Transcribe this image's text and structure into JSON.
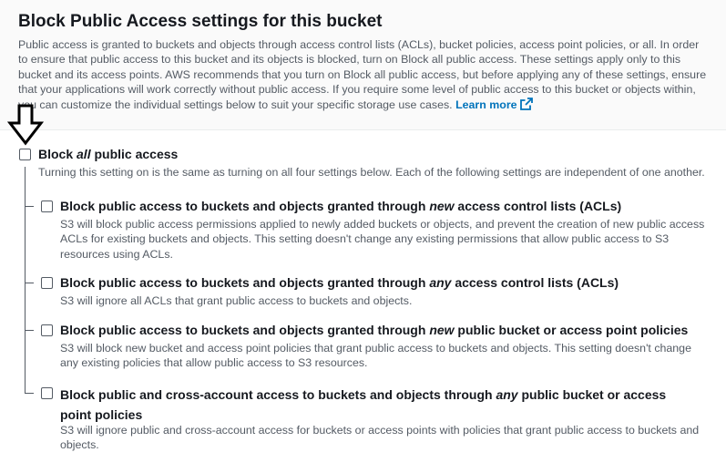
{
  "header": {
    "title": "Block Public Access settings for this bucket",
    "description": "Public access is granted to buckets and objects through access control lists (ACLs), bucket policies, access point policies, or all. In order to ensure that public access to this bucket and its objects is blocked, turn on Block all public access. These settings apply only to this bucket and its access points. AWS recommends that you turn on Block all public access, but before applying any of these settings, ensure that your applications will work correctly without public access. If you require some level of public access to this bucket or objects within, you can customize the individual settings below to suit your specific storage use cases.",
    "learn_more": "Learn more"
  },
  "block_all": {
    "label_prefix": "Block ",
    "label_em": "all",
    "label_suffix": " public access",
    "checked": false,
    "description": "Turning this setting on is the same as turning on all four settings below. Each of the following settings are independent of one another."
  },
  "settings": [
    {
      "label_prefix": "Block public access to buckets and objects granted through ",
      "label_em": "new",
      "label_suffix": " access control lists (ACLs)",
      "checked": false,
      "description": "S3 will block public access permissions applied to newly added buckets or objects, and prevent the creation of new public access ACLs for existing buckets and objects. This setting doesn't change any existing permissions that allow public access to S3 resources using ACLs."
    },
    {
      "label_prefix": "Block public access to buckets and objects granted through ",
      "label_em": "any",
      "label_suffix": " access control lists (ACLs)",
      "checked": false,
      "description": "S3 will ignore all ACLs that grant public access to buckets and objects."
    },
    {
      "label_prefix": "Block public access to buckets and objects granted through ",
      "label_em": "new",
      "label_suffix": " public bucket or access point policies",
      "checked": false,
      "description": "S3 will block new bucket and access point policies that grant public access to buckets and objects. This setting doesn't change any existing policies that allow public access to S3 resources."
    },
    {
      "label_prefix": "Block public and cross-account access to buckets and objects through ",
      "label_em": "any",
      "label_suffix": " public bucket or access point policies",
      "checked": false,
      "description": "S3 will ignore public and cross-account access for buckets or access points with policies that grant public access to buckets and objects."
    }
  ],
  "colors": {
    "text": "#16191f",
    "secondary_text": "#545b64",
    "link": "#0073bb",
    "header_bg": "#fafafa"
  },
  "icons": {
    "external_link": "external-link-icon",
    "annotation_arrow": "down-arrow-icon"
  }
}
